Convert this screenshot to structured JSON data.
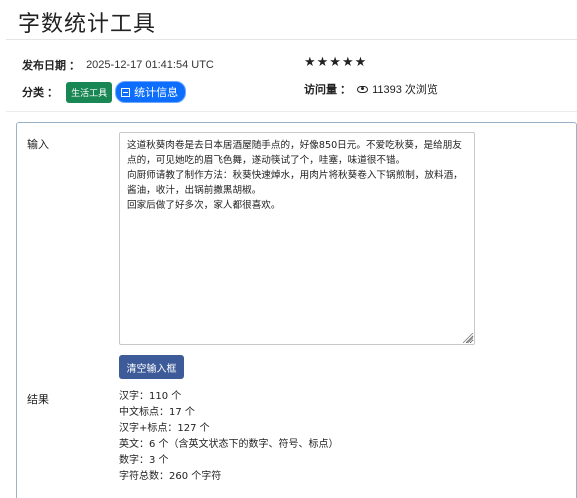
{
  "page": {
    "title": "字数统计工具"
  },
  "meta": {
    "date_label": "发布日期 ：",
    "date_value": "2025-12-17 01:41:54 UTC",
    "category_label": "分类 ：",
    "category_tag": "生活工具",
    "category_badge": "统计信息",
    "rating_stars": "★★★★★",
    "rating_value": 5,
    "visits_label": "访问量 ：",
    "visits_value": "11393 次浏览"
  },
  "form": {
    "input_label": "输入",
    "input_text": "这道秋葵肉卷是去日本居酒屋随手点的，好像850日元。不爱吃秋葵，是给朋友点的，可见她吃的眉飞色舞，遂动筷试了个，哇塞，味道很不错。\n向厨师请教了制作方法：秋葵快速焯水，用肉片将秋葵卷入下锅煎制，放料酒，酱油，收汁，出锅前撒黑胡椒。\n回家后做了好多次，家人都很喜欢。",
    "clear_button": "清空输入框",
    "result_label": "结果"
  },
  "results": [
    "汉字：110 个",
    "中文标点：17 个",
    "汉字+标点：127 个",
    "英文：6 个（含英文状态下的数字、符号、标点）",
    "数字：3 个",
    "字符总数：260 个字符"
  ],
  "colors": {
    "tag_green": "#198754",
    "badge_blue": "#0d6efd",
    "button_blue": "#3d5a99",
    "card_border": "#9ab2c8"
  }
}
